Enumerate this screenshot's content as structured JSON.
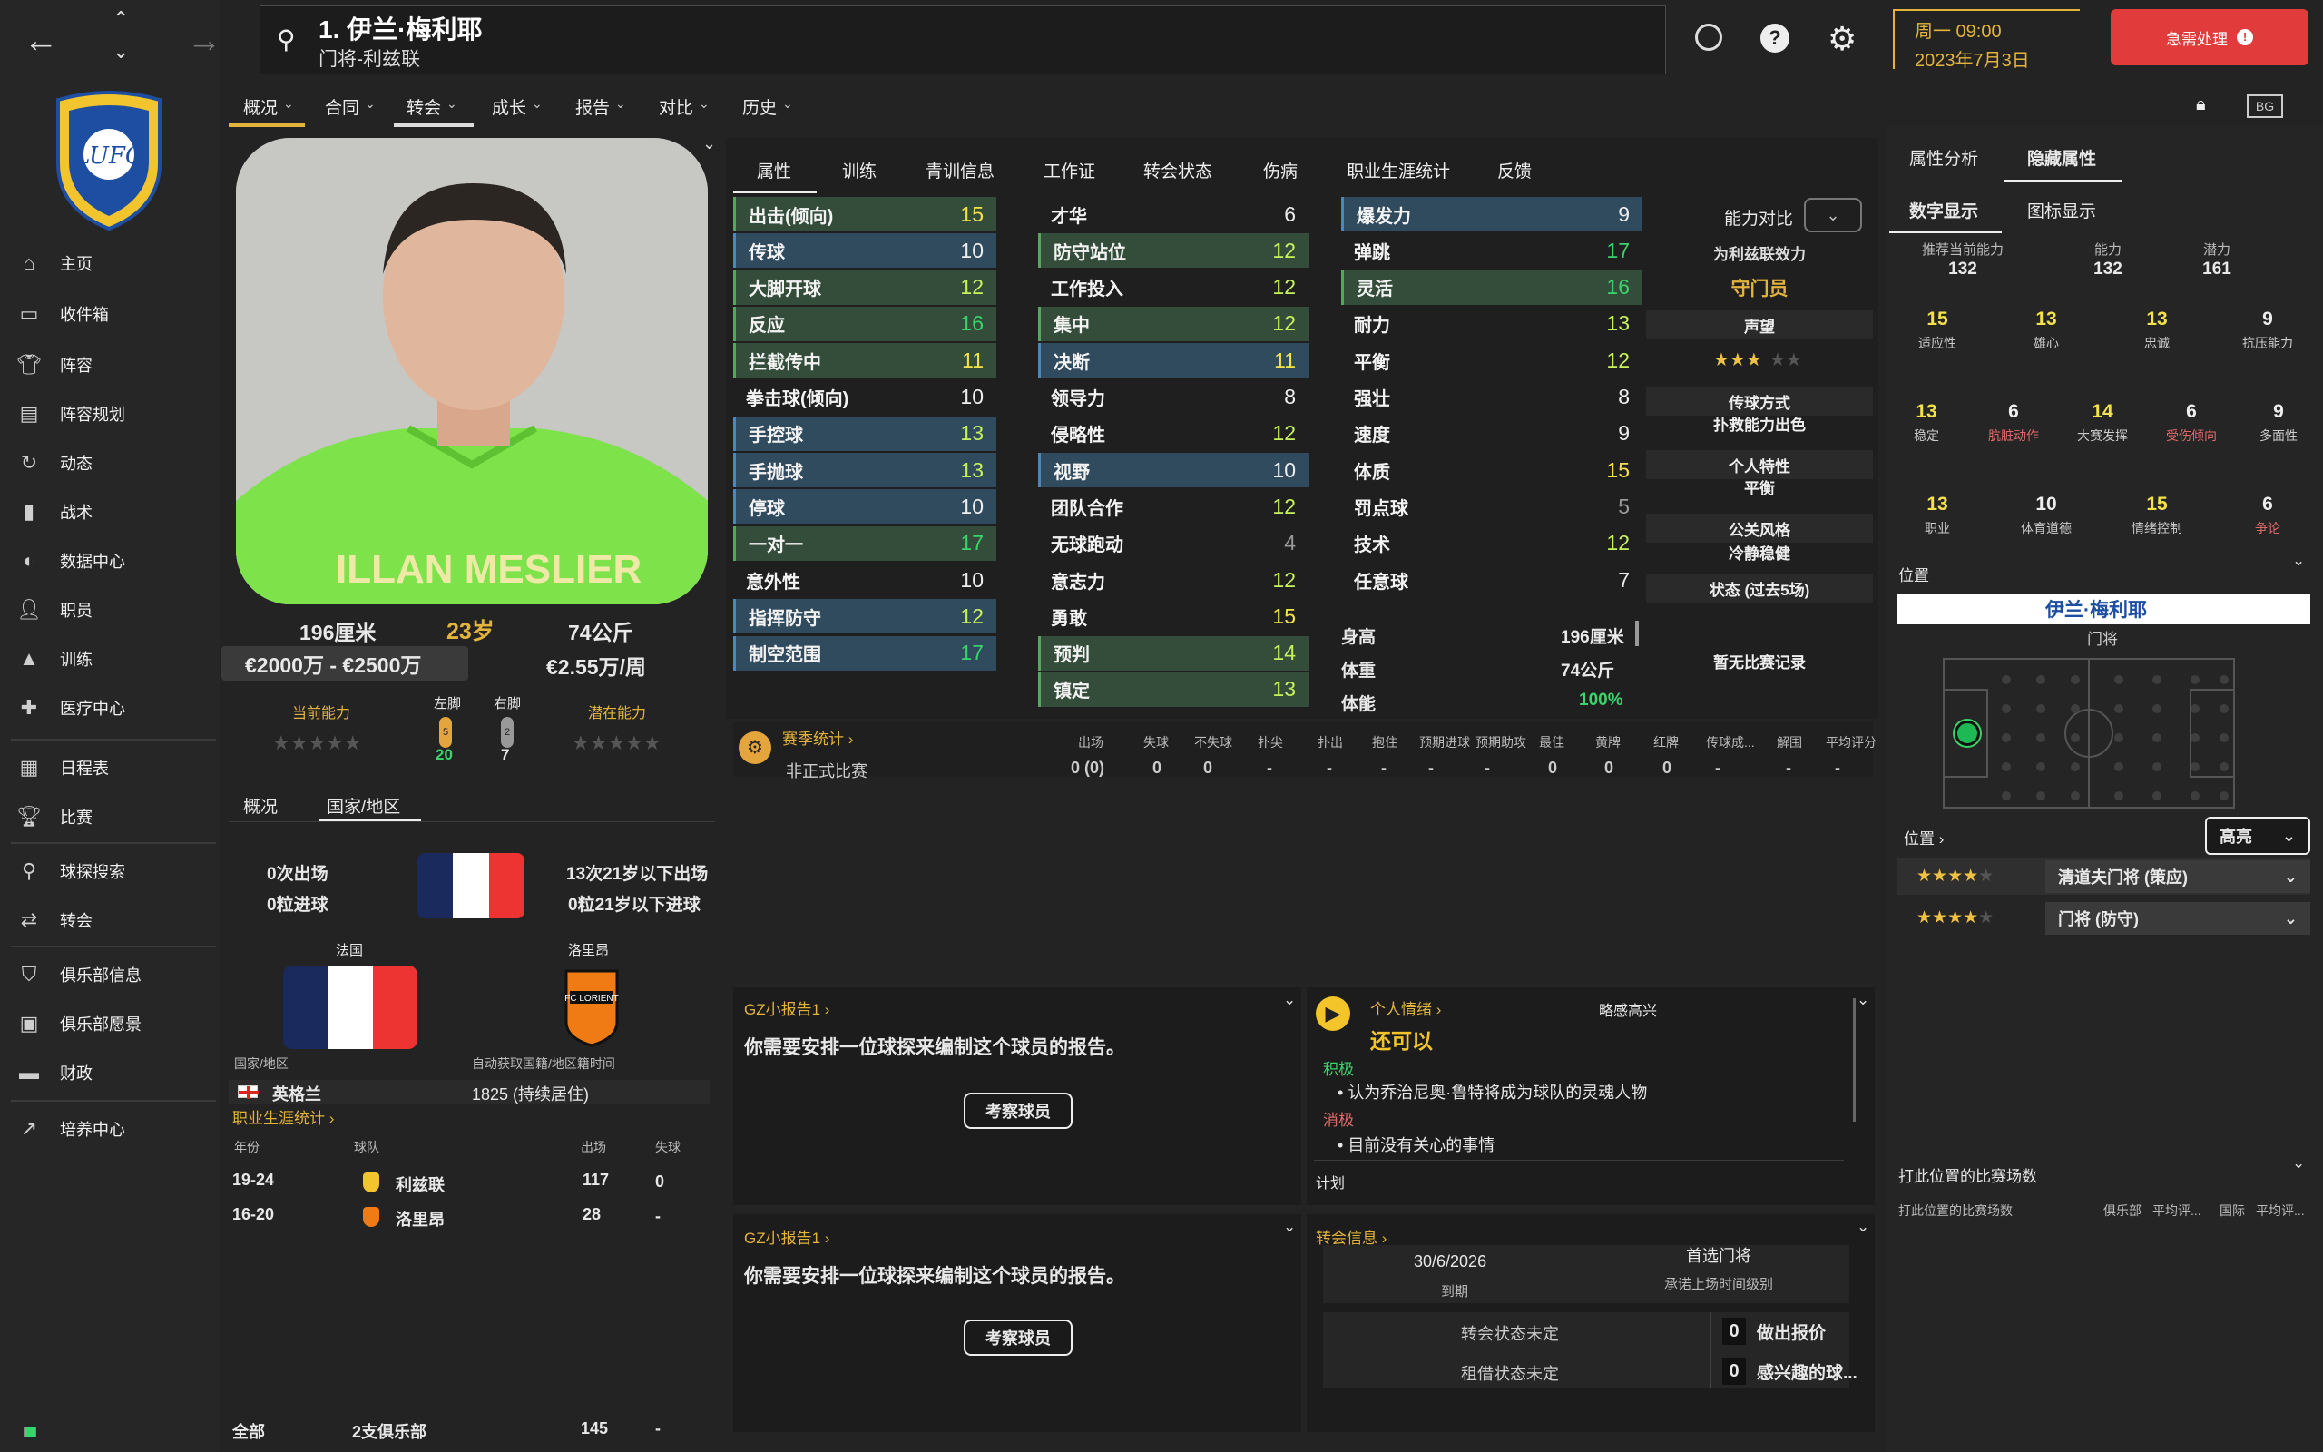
{
  "nav": {
    "back": "←",
    "forward": "→",
    "up": "⌃",
    "down": "⌄"
  },
  "player_header": {
    "name": "1. 伊兰·梅利耶",
    "subtitle": "门将-利兹联"
  },
  "top_right": {
    "day_time": "周一 09:00",
    "date": "2023年7月3日",
    "urgent": "急需处理"
  },
  "sidebar": {
    "items": [
      {
        "label": "主页",
        "icon": "home-icon"
      },
      {
        "label": "收件箱",
        "icon": "inbox-icon"
      },
      {
        "label": "阵容",
        "icon": "shirt-icon"
      },
      {
        "label": "阵容规划",
        "icon": "clipboard-icon"
      },
      {
        "label": "动态",
        "icon": "refresh-icon"
      },
      {
        "label": "战术",
        "icon": "tactics-icon"
      },
      {
        "label": "数据中心",
        "icon": "data-icon"
      },
      {
        "label": "职员",
        "icon": "staff-icon"
      },
      {
        "label": "训练",
        "icon": "training-icon"
      },
      {
        "label": "医疗中心",
        "icon": "medical-icon"
      },
      {
        "label": "日程表",
        "icon": "calendar-icon"
      },
      {
        "label": "比赛",
        "icon": "trophy-icon"
      },
      {
        "label": "球探搜索",
        "icon": "search-icon"
      },
      {
        "label": "转会",
        "icon": "transfer-icon"
      },
      {
        "label": "俱乐部信息",
        "icon": "shield-icon"
      },
      {
        "label": "俱乐部愿景",
        "icon": "briefcase-icon"
      },
      {
        "label": "财政",
        "icon": "money-icon"
      },
      {
        "label": "培养中心",
        "icon": "growth-icon"
      }
    ]
  },
  "menu_tabs": [
    "概况",
    "合同",
    "转会",
    "成长",
    "报告",
    "对比",
    "历史"
  ],
  "profile": {
    "height": "196厘米",
    "age": "23岁",
    "weight": "74公斤",
    "value": "€2000万 - €2500万",
    "wage": "€2.55万/周",
    "current_ability_label": "当前能力",
    "potential_label": "潜在能力",
    "left_foot_label": "左脚",
    "right_foot_label": "右脚",
    "left_foot_value": "20",
    "right_foot_value": "7",
    "left_badge": "5",
    "right_badge": "2",
    "shirt_text": "ILLAN MESLIER"
  },
  "nation_tabs": [
    "概况",
    "国家/地区"
  ],
  "nation": {
    "caps": "0次出场",
    "goals": "0粒进球",
    "u21_caps": "13次21岁以下出场",
    "u21_goals": "0粒21岁以下进球",
    "country": "法国",
    "club_from": "洛里昂",
    "nation_label": "国家/地区",
    "homegrown_label": "自动获取国籍/地区籍时间",
    "second_nation": "英格兰",
    "residence": "1825 (持续居住)"
  },
  "career": {
    "title": "职业生涯统计 ›",
    "headers": [
      "年份",
      "球队",
      "出场",
      "失球"
    ],
    "rows": [
      {
        "years": "19-24",
        "team": "利兹联",
        "apps": "117",
        "conceded": "0"
      },
      {
        "years": "16-20",
        "team": "洛里昂",
        "apps": "28",
        "conceded": "-"
      }
    ],
    "total": {
      "label": "全部",
      "teams": "2支俱乐部",
      "apps": "145",
      "conceded": "-"
    }
  },
  "attr_tabs": [
    "属性",
    "训练",
    "青训信息",
    "工作证",
    "转会状态",
    "伤病",
    "职业生涯统计",
    "反馈"
  ],
  "goalkeeping": [
    {
      "n": "出击(倾向)",
      "v": "15",
      "c": "y",
      "h": "hlg"
    },
    {
      "n": "传球",
      "v": "10",
      "c": "w",
      "h": "hl"
    },
    {
      "n": "大脚开球",
      "v": "12",
      "c": "g",
      "h": "hlg"
    },
    {
      "n": "反应",
      "v": "16",
      "c": "gr",
      "h": "hlg"
    },
    {
      "n": "拦截传中",
      "v": "11",
      "c": "y",
      "h": "hlg"
    },
    {
      "n": "拳击球(倾向)",
      "v": "10",
      "c": "w",
      "h": ""
    },
    {
      "n": "手控球",
      "v": "13",
      "c": "g",
      "h": "hl"
    },
    {
      "n": "手抛球",
      "v": "13",
      "c": "g",
      "h": "hl"
    },
    {
      "n": "停球",
      "v": "10",
      "c": "w",
      "h": "hl"
    },
    {
      "n": "一对一",
      "v": "17",
      "c": "gr",
      "h": "hlg"
    },
    {
      "n": "意外性",
      "v": "10",
      "c": "w",
      "h": ""
    },
    {
      "n": "指挥防守",
      "v": "12",
      "c": "g",
      "h": "hl"
    },
    {
      "n": "制空范围",
      "v": "17",
      "c": "gr",
      "h": "hl"
    }
  ],
  "mental": [
    {
      "n": "才华",
      "v": "6",
      "c": "w",
      "h": ""
    },
    {
      "n": "防守站位",
      "v": "12",
      "c": "g",
      "h": "hlg"
    },
    {
      "n": "工作投入",
      "v": "12",
      "c": "g",
      "h": ""
    },
    {
      "n": "集中",
      "v": "12",
      "c": "g",
      "h": "hlg"
    },
    {
      "n": "决断",
      "v": "11",
      "c": "y",
      "h": "hl"
    },
    {
      "n": "领导力",
      "v": "8",
      "c": "w",
      "h": ""
    },
    {
      "n": "侵略性",
      "v": "12",
      "c": "g",
      "h": ""
    },
    {
      "n": "视野",
      "v": "10",
      "c": "w",
      "h": "hl"
    },
    {
      "n": "团队合作",
      "v": "12",
      "c": "g",
      "h": ""
    },
    {
      "n": "无球跑动",
      "v": "4",
      "c": "dim",
      "h": ""
    },
    {
      "n": "意志力",
      "v": "12",
      "c": "g",
      "h": ""
    },
    {
      "n": "勇敢",
      "v": "15",
      "c": "y",
      "h": ""
    },
    {
      "n": "预判",
      "v": "14",
      "c": "g",
      "h": "hlg"
    },
    {
      "n": "镇定",
      "v": "13",
      "c": "g",
      "h": "hlg"
    }
  ],
  "physical": [
    {
      "n": "爆发力",
      "v": "9",
      "c": "w",
      "h": "hl"
    },
    {
      "n": "弹跳",
      "v": "17",
      "c": "gr",
      "h": ""
    },
    {
      "n": "灵活",
      "v": "16",
      "c": "gr",
      "h": "hlg"
    },
    {
      "n": "耐力",
      "v": "13",
      "c": "g",
      "h": ""
    },
    {
      "n": "平衡",
      "v": "12",
      "c": "g",
      "h": ""
    },
    {
      "n": "强壮",
      "v": "8",
      "c": "w",
      "h": ""
    },
    {
      "n": "速度",
      "v": "9",
      "c": "w",
      "h": ""
    },
    {
      "n": "体质",
      "v": "15",
      "c": "y",
      "h": ""
    },
    {
      "n": "罚点球",
      "v": "5",
      "c": "dim",
      "h": ""
    },
    {
      "n": "技术",
      "v": "12",
      "c": "g",
      "h": ""
    },
    {
      "n": "任意球",
      "v": "7",
      "c": "w",
      "h": ""
    }
  ],
  "phys_extra": [
    {
      "n": "身高",
      "v": "196厘米"
    },
    {
      "n": "体重",
      "v": "74公斤"
    },
    {
      "n": "体能",
      "v": "100%"
    }
  ],
  "compare": {
    "title": "能力对比",
    "plays_for": "为利兹联效力",
    "role": "守门员",
    "rep_label": "声望",
    "pass_label": "传球方式",
    "pass_value": "扑救能力出色",
    "trait_label": "个人特性",
    "trait_value": "平衡",
    "media_label": "公关风格",
    "media_value": "冷静稳健",
    "form_label": "状态 (过去5场)",
    "form_value": "暂无比赛记录"
  },
  "season": {
    "title": "赛季统计 ›",
    "headers": [
      "出场",
      "失球",
      "不失球",
      "扑尖",
      "扑出",
      "抱住",
      "预期进球",
      "预期助攻",
      "最佳",
      "黄牌",
      "红牌",
      "传球成...",
      "解围",
      "平均评分"
    ],
    "row_label": "非正式比赛",
    "row": [
      "0 (0)",
      "0",
      "0",
      "-",
      "-",
      "-",
      "-",
      "-",
      "0",
      "0",
      "0",
      "-",
      "-",
      "-"
    ]
  },
  "report1": {
    "title": "GZ小报告1 ›",
    "text": "你需要安排一位球探来编制这个球员的报告。",
    "button": "考察球员"
  },
  "report2": {
    "title": "GZ小报告1 ›",
    "text": "你需要安排一位球探来编制这个球员的报告。",
    "button": "考察球员"
  },
  "mood": {
    "title": "个人情绪 ›",
    "mood_text": "略感高兴",
    "status": "还可以",
    "pos_label": "积极",
    "pos_item": "认为乔治尼奥·鲁特将成为球队的灵魂人物",
    "neg_label": "消极",
    "neg_item": "目前没有关心的事情",
    "plan_label": "计划"
  },
  "transfer": {
    "title": "转会信息 ›",
    "expire_date": "30/6/2026",
    "expire_label": "到期",
    "status_title": "首选门将",
    "status_sub": "承诺上场时间级别",
    "transfer_status": "转会状态未定",
    "loan_status": "租借状态未定",
    "offers_count": "0",
    "offers_label": "做出报价",
    "interest_count": "0",
    "interest_label": "感兴趣的球..."
  },
  "right_tabs": [
    "属性分析",
    "隐藏属性"
  ],
  "right_subtabs": [
    "数字显示",
    "图标显示"
  ],
  "ca_row": [
    {
      "l": "推荐当前能力",
      "v": "132"
    },
    {
      "l": "能力",
      "v": "132"
    },
    {
      "l": "潜力",
      "v": "161"
    }
  ],
  "hidden": [
    {
      "v": "15",
      "l": "适应性",
      "c": "#f3e24a",
      "lc": "#ccc"
    },
    {
      "v": "13",
      "l": "雄心",
      "c": "#f3e24a",
      "lc": "#ccc"
    },
    {
      "v": "13",
      "l": "忠诚",
      "c": "#f3e24a",
      "lc": "#ccc"
    },
    {
      "v": "9",
      "l": "抗压能力",
      "c": "#eee",
      "lc": "#ccc"
    },
    {
      "v": "13",
      "l": "稳定",
      "c": "#f3e24a",
      "lc": "#ccc"
    },
    {
      "v": "6",
      "l": "肮脏动作",
      "c": "#eee",
      "lc": "#e06a6a"
    },
    {
      "v": "14",
      "l": "大赛发挥",
      "c": "#f3e24a",
      "lc": "#ccc"
    },
    {
      "v": "6",
      "l": "受伤倾向",
      "c": "#eee",
      "lc": "#e06a6a"
    },
    {
      "v": "9",
      "l": "多面性",
      "c": "#eee",
      "lc": "#ccc"
    },
    {
      "v": "13",
      "l": "职业",
      "c": "#f3e24a",
      "lc": "#ccc"
    },
    {
      "v": "10",
      "l": "体育道德",
      "c": "#eee",
      "lc": "#ccc"
    },
    {
      "v": "15",
      "l": "情绪控制",
      "c": "#f3e24a",
      "lc": "#ccc"
    },
    {
      "v": "6",
      "l": "争论",
      "c": "#eee",
      "lc": "#e06a6a"
    }
  ],
  "position": {
    "title": "位置",
    "player_name": "伊兰·梅利耶",
    "pos": "门将",
    "pos_label": "位置 ›",
    "highlight": "高亮",
    "role1": "清道夫门将 (策应)",
    "role2": "门将 (防守)"
  },
  "matches_pos": {
    "title": "打此位置的比赛场数",
    "sub": "打此位置的比赛场数",
    "cols": [
      "俱乐部",
      "平均评...",
      "国际",
      "平均评..."
    ]
  },
  "colors": {
    "accent_red": "#e23b3b",
    "gold": "#e3b43c",
    "green": "#3bd36b"
  }
}
